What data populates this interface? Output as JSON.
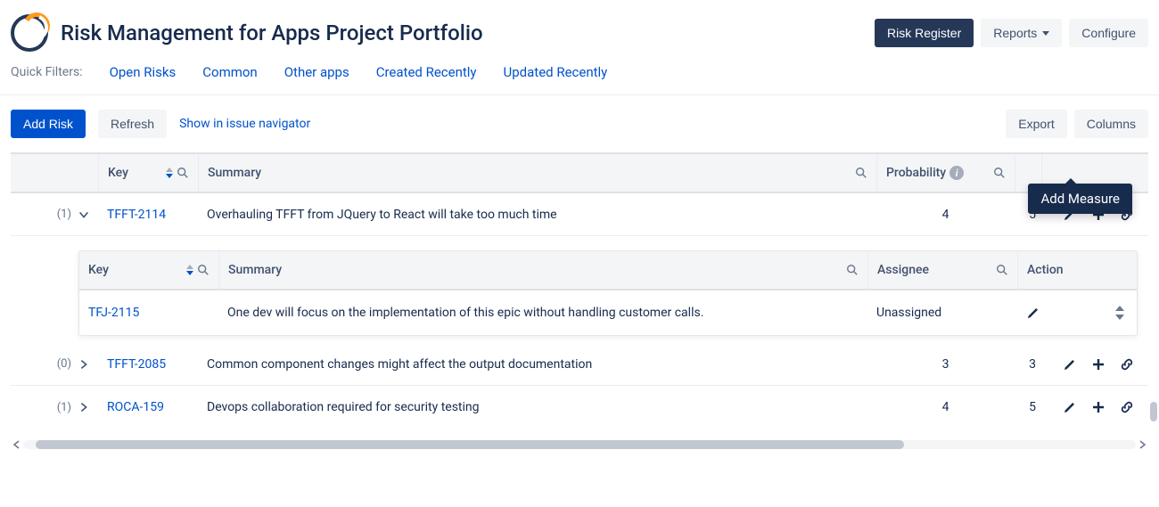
{
  "header": {
    "title": "Risk Management for Apps Project Portfolio",
    "risk_register": "Risk Register",
    "reports": "Reports",
    "configure": "Configure"
  },
  "quickFilters": {
    "label": "Quick Filters:",
    "items": [
      "Open Risks",
      "Common",
      "Other apps",
      "Created Recently",
      "Updated Recently"
    ]
  },
  "toolbar": {
    "add_risk": "Add Risk",
    "refresh": "Refresh",
    "show_nav": "Show in issue navigator",
    "export": "Export",
    "columns": "Columns"
  },
  "columns": {
    "key": "Key",
    "summary": "Summary",
    "probability": "Probability"
  },
  "rows": [
    {
      "count": "(1)",
      "expanded": true,
      "key": "TFFT-2114",
      "summary": "Overhauling TFFT from JQuery to React will take too much time",
      "probability": "4",
      "impact": "5"
    },
    {
      "count": "(0)",
      "expanded": false,
      "key": "TFFT-2085",
      "summary": "Common component changes might affect the output documentation",
      "probability": "3",
      "impact": "3"
    },
    {
      "count": "(1)",
      "expanded": false,
      "key": "ROCA-159",
      "summary": "Devops collaboration required for security testing",
      "probability": "4",
      "impact": "5"
    }
  ],
  "sub": {
    "columns": {
      "key": "Key",
      "summary": "Summary",
      "assignee": "Assignee",
      "action": "Action"
    },
    "rows": [
      {
        "key": "TFJ-2115",
        "summary": "One dev will focus on the implementation of this epic without handling customer calls.",
        "assignee": "Unassigned"
      }
    ]
  },
  "tooltip": "Add Measure"
}
